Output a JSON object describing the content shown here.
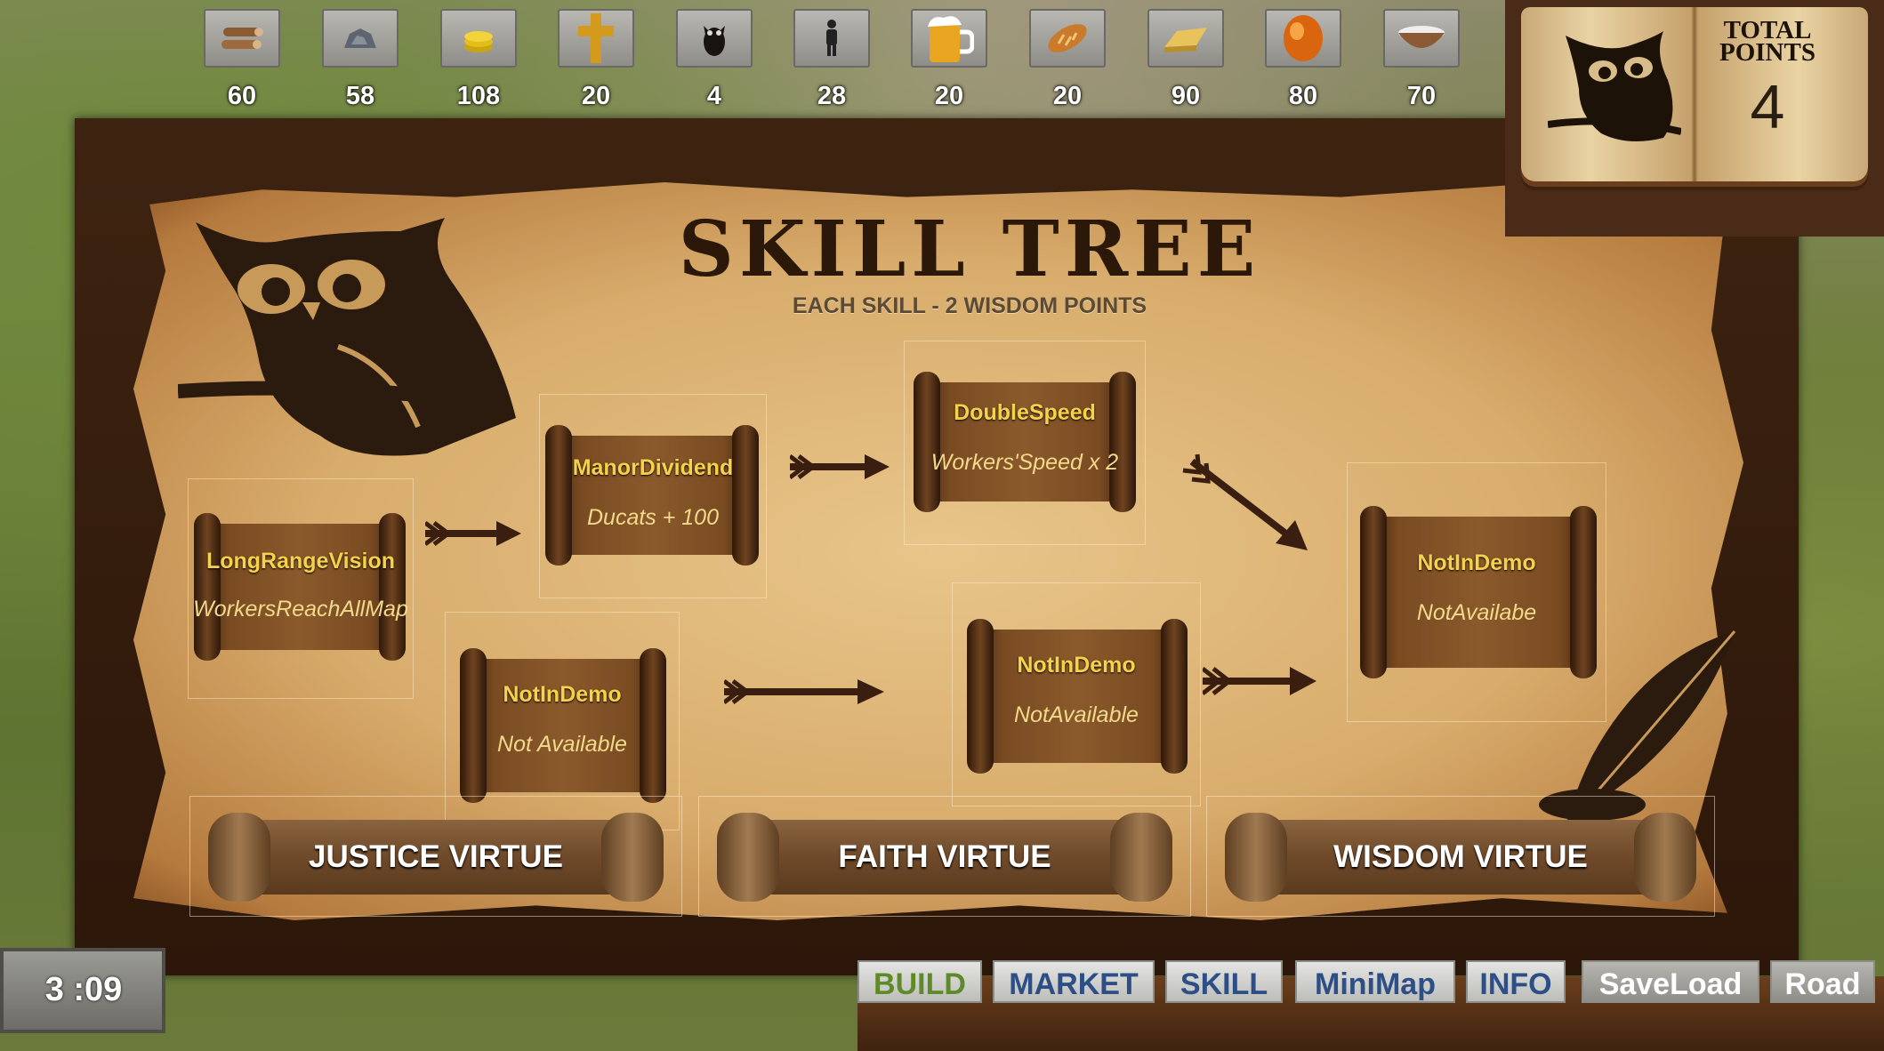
{
  "resources": [
    {
      "icon": "wood-logs-icon",
      "value": "60"
    },
    {
      "icon": "stone-ore-icon",
      "value": "58"
    },
    {
      "icon": "gold-coins-icon",
      "value": "108"
    },
    {
      "icon": "faith-cross-icon",
      "value": "20"
    },
    {
      "icon": "wisdom-owl-icon",
      "value": "4"
    },
    {
      "icon": "population-person-icon",
      "value": "28"
    },
    {
      "icon": "beer-mug-icon",
      "value": "20"
    },
    {
      "icon": "bread-icon",
      "value": "20"
    },
    {
      "icon": "gold-bar-icon",
      "value": "90"
    },
    {
      "icon": "amber-gem-icon",
      "value": "80"
    },
    {
      "icon": "salt-bowl-icon",
      "value": "70"
    }
  ],
  "points_panel": {
    "title": "TOTAL\nPOINTS",
    "value": "4"
  },
  "skill_tree": {
    "title": "SKILL TREE",
    "subtitle": "EACH SKILL - 2 WISDOM POINTS",
    "skills": [
      {
        "name": "LongRangeVision",
        "desc": "WorkersReachAllMap"
      },
      {
        "name": "ManorDividend",
        "desc": "Ducats + 100"
      },
      {
        "name": "DoubleSpeed",
        "desc": "Workers'Speed x 2"
      },
      {
        "name": "NotInDemo",
        "desc": "NotAvailabe"
      },
      {
        "name": "NotInDemo",
        "desc": "Not Available"
      },
      {
        "name": "NotInDemo",
        "desc": "NotAvailable"
      }
    ],
    "virtues": [
      "JUSTICE VIRTUE",
      "FAITH VIRTUE",
      "WISDOM VIRTUE"
    ]
  },
  "timer": "3 :09",
  "menu": [
    {
      "label": "BUILD",
      "color": "#5f8a2a"
    },
    {
      "label": "MARKET",
      "color": "#2d4f86"
    },
    {
      "label": "SKILL",
      "color": "#2d4f86"
    },
    {
      "label": "MiniMap",
      "color": "#2d4f86"
    },
    {
      "label": "INFO",
      "color": "#2d4f86"
    },
    {
      "label": "SaveLoad",
      "color": "#ffffff"
    },
    {
      "label": "Road",
      "color": "#ffffff"
    }
  ]
}
